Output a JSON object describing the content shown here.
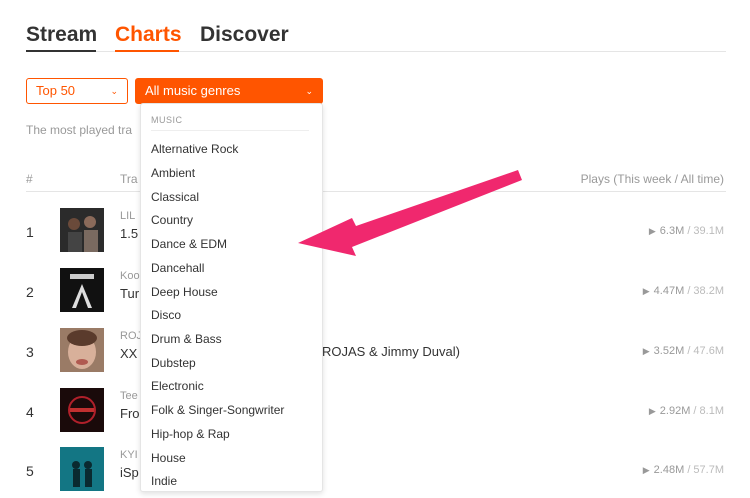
{
  "tabs": [
    "Stream",
    "Charts",
    "Discover"
  ],
  "controls": {
    "chart_type": "Top 50",
    "genre": "All music genres"
  },
  "subtitle": "The most played tra",
  "table": {
    "col_num": "#",
    "col_track": "Tra",
    "col_plays": "Plays (This week / All time)"
  },
  "rows": [
    {
      "rank": "1",
      "artist": "LIL",
      "title": "1.5",
      "week": "6.3M",
      "all": "/ 39.1M"
    },
    {
      "rank": "2",
      "artist": "Koo",
      "title": "Tur",
      "week": "4.47M",
      "all": "/ 38.2M"
    },
    {
      "rank": "3",
      "artist": "ROJ",
      "title": "XX",
      "week": "3.52M",
      "all": "/ 47.6M"
    },
    {
      "rank": "4",
      "artist": "Tee",
      "title": "Fro",
      "week": "2.92M",
      "all": "/ 8.1M"
    },
    {
      "rank": "5",
      "artist": "KYI",
      "title": "iSp",
      "week": "2.48M",
      "all": "/ 57.7M"
    }
  ],
  "row3_title_tail": "ROJAS & Jimmy Duval)",
  "dropdown": {
    "section": "MUSIC",
    "items": [
      "Alternative Rock",
      "Ambient",
      "Classical",
      "Country",
      "Dance & EDM",
      "Dancehall",
      "Deep House",
      "Disco",
      "Drum & Bass",
      "Dubstep",
      "Electronic",
      "Folk & Singer-Songwriter",
      "Hip-hop & Rap",
      "House",
      "Indie"
    ]
  },
  "colors": {
    "accent": "#ff5500",
    "annotation_arrow": "#f0286e"
  },
  "icons": [
    "chevron-down-icon",
    "play-icon"
  ]
}
